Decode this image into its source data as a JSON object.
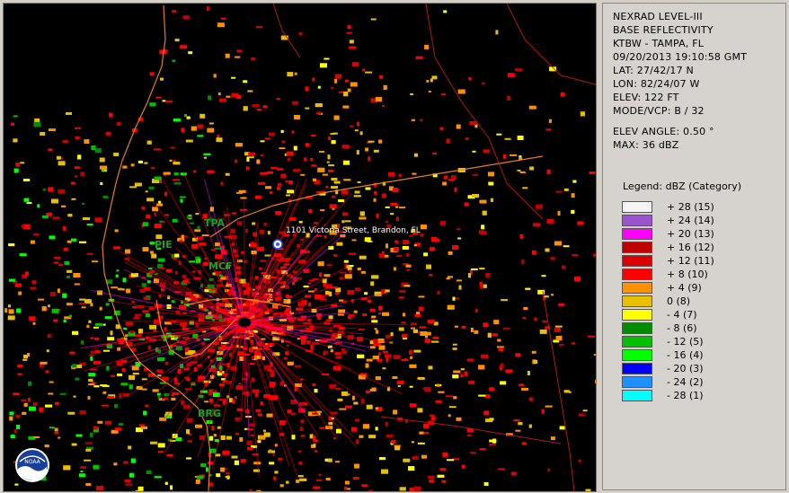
{
  "info": {
    "lines": [
      "NEXRAD LEVEL-III",
      "BASE REFLECTIVITY",
      "KTBW - TAMPA, FL",
      "09/20/2013 19:10:58 GMT",
      "LAT: 27/42/17 N",
      "LON: 82/24/07 W",
      "ELEV: 122 FT",
      "MODE/VCP: B / 32"
    ],
    "elev_angle": "ELEV ANGLE: 0.50 °",
    "max": "MAX: 36 dBZ"
  },
  "legend": {
    "title": "Legend: dBZ (Category)",
    "items": [
      {
        "label": "+ 28  (15)",
        "color": "#f4f4f4"
      },
      {
        "label": "+ 24  (14)",
        "color": "#9a55cc"
      },
      {
        "label": "+ 20  (13)",
        "color": "#ff00ff"
      },
      {
        "label": "+ 16  (12)",
        "color": "#c00000"
      },
      {
        "label": "+ 12  (11)",
        "color": "#dd0000"
      },
      {
        "label": "+ 8  (10)",
        "color": "#ff0000"
      },
      {
        "label": "+ 4  (9)",
        "color": "#ff9000"
      },
      {
        "label": "0  (8)",
        "color": "#e8c000"
      },
      {
        "label": "- 4  (7)",
        "color": "#ffff00"
      },
      {
        "label": "- 8  (6)",
        "color": "#008c00"
      },
      {
        "label": "- 12  (5)",
        "color": "#00c000"
      },
      {
        "label": "- 16  (4)",
        "color": "#00ff00"
      },
      {
        "label": "- 20  (3)",
        "color": "#0000ff"
      },
      {
        "label": "- 24  (2)",
        "color": "#1e90ff"
      },
      {
        "label": "- 28  (1)",
        "color": "#00ffff"
      }
    ]
  },
  "map": {
    "stations": [
      "TPA",
      "PIE",
      "MCF",
      "BRG"
    ],
    "address": "1101 Victoria Street, Brandon, FL",
    "logo_text": "NOAA"
  }
}
